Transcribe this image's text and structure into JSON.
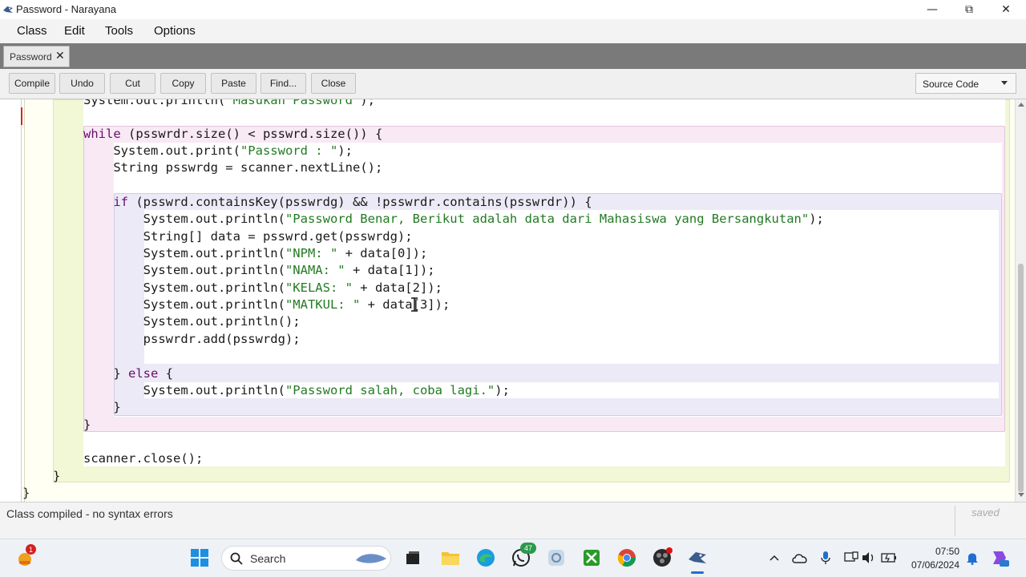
{
  "window": {
    "title": "Password - Narayana",
    "minimize_glyph": "—",
    "maximize_glyph": "⧉",
    "close_glyph": "✕"
  },
  "menu": [
    "Class",
    "Edit",
    "Tools",
    "Options"
  ],
  "tabs": [
    {
      "label": "Password",
      "close_glyph": "✕"
    }
  ],
  "toolbar": {
    "buttons": [
      "Compile",
      "Undo",
      "Cut",
      "Copy",
      "Paste",
      "Find...",
      "Close"
    ],
    "view_select": "Source Code"
  },
  "code": {
    "lines": [
      {
        "text": "System.out.println(\"Masukan Password\");"
      },
      {
        "text": ""
      },
      {
        "text": "while (psswrdr.size() < psswrd.size()) {"
      },
      {
        "text": "    System.out.print(\"Password : \");"
      },
      {
        "text": "    String psswrdg = scanner.nextLine();"
      },
      {
        "text": ""
      },
      {
        "text": "    if (psswrd.containsKey(psswrdg) && !psswrdr.contains(psswrdr)) {"
      },
      {
        "text": "        System.out.println(\"Password Benar, Berikut adalah data dari Mahasiswa yang Bersangkutan\");"
      },
      {
        "text": "        String[] data = psswrd.get(psswrdg);"
      },
      {
        "text": "        System.out.println(\"NPM: \" + data[0]);"
      },
      {
        "text": "        System.out.println(\"NAMA: \" + data[1]);"
      },
      {
        "text": "        System.out.println(\"KELAS: \" + data[2]);"
      },
      {
        "text": "        System.out.println(\"MATKUL: \" + data[3]);"
      },
      {
        "text": "        System.out.println();"
      },
      {
        "text": "        psswrdr.add(psswrdg);"
      },
      {
        "text": ""
      },
      {
        "text": "    } else {"
      },
      {
        "text": "        System.out.println(\"Password salah, coba lagi.\");"
      },
      {
        "text": "    }"
      },
      {
        "text": "}"
      },
      {
        "text": ""
      },
      {
        "text": "scanner.close();"
      },
      {
        "text": "}"
      },
      {
        "text": "}"
      }
    ]
  },
  "status": {
    "message": "Class compiled - no syntax errors",
    "saved": "saved"
  },
  "taskbar": {
    "search_label": "Search",
    "widgets_badge": "1",
    "whatsapp_badge": "47",
    "time": "07:50",
    "date": "07/06/2024",
    "icons": [
      "weather-widget-icon",
      "windows-start-icon",
      "search-icon",
      "task-view-icon",
      "file-explorer-icon",
      "edge-icon",
      "whatsapp-icon",
      "copilot-icon",
      "xbox-icon",
      "chrome-icon",
      "obs-icon",
      "bluej-icon"
    ]
  }
}
